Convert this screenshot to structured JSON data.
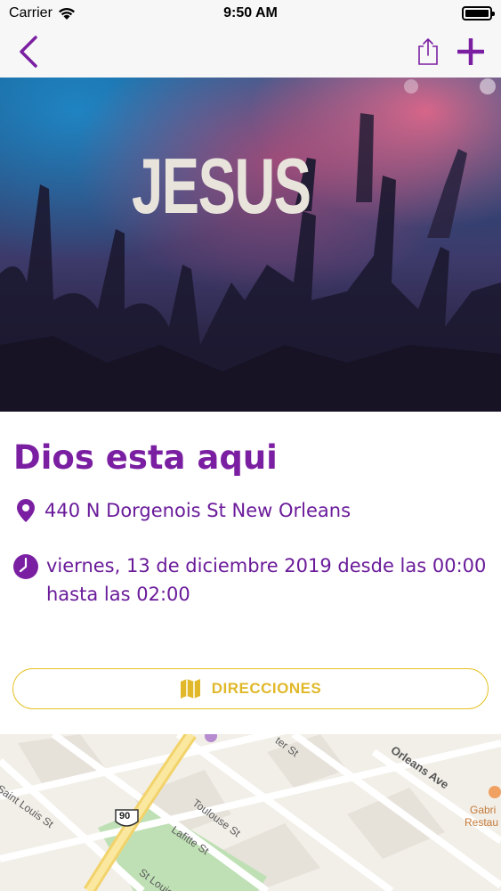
{
  "status": {
    "carrier": "Carrier",
    "time": "9:50 AM"
  },
  "nav": {
    "back_icon": "chevron-left-icon",
    "share_icon": "share-icon",
    "add_icon": "plus-icon",
    "accent": "#7b1fa2"
  },
  "hero": {
    "sign_text": "JESUS"
  },
  "event": {
    "title": "Dios esta aqui",
    "location": "440 N Dorgenois St New Orleans",
    "datetime": "viernes, 13 de diciembre 2019 desde las 00:00 hasta las 02:00",
    "location_icon": "map-pin-icon",
    "time_icon": "clock-icon"
  },
  "directions": {
    "label": "DIRECCIONES",
    "icon": "map-icon",
    "color": "#e0b82a"
  },
  "map": {
    "labels": {
      "st_louis": "Saint Louis St",
      "toulouse": "Toulouse St",
      "lafitte": "Lafitte St",
      "st_louis_bottom": "St Louis",
      "orleans": "Orleans Ave",
      "ter": "ter St",
      "highway": "90",
      "gabri": "Gabri",
      "restau": "Restau"
    }
  }
}
